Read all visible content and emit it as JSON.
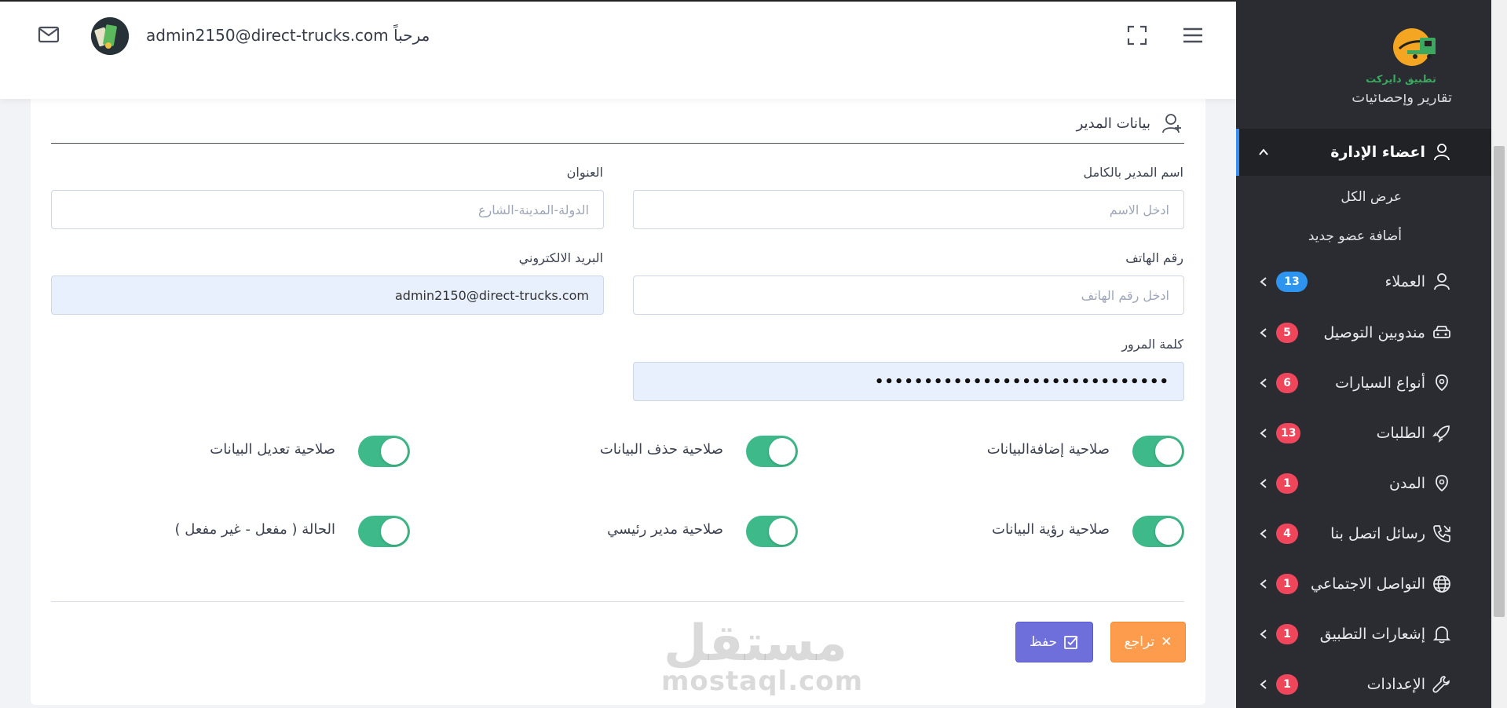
{
  "header": {
    "welcome_text": "admin2150@direct-trucks.com مرحباً"
  },
  "form": {
    "section_title": "بيانات المدير",
    "full_name": {
      "label": "اسم المدير بالكامل",
      "placeholder": "ادخل الاسم"
    },
    "address": {
      "label": "العنوان",
      "placeholder": "الدولة-المدينة-الشارع"
    },
    "phone": {
      "label": "رقم الهاتف",
      "placeholder": "ادخل رقم الهاتف"
    },
    "email": {
      "label": "البريد الالكتروني",
      "value": "admin2150@direct-trucks.com"
    },
    "password": {
      "label": "كلمة المرور",
      "value": "••••••••••••••••••••••••••••••"
    },
    "permissions": [
      {
        "label": "صلاحية إضافةالبيانات",
        "enabled": true
      },
      {
        "label": "صلاحية حذف البيانات",
        "enabled": true
      },
      {
        "label": "صلاحية تعديل البيانات",
        "enabled": true
      },
      {
        "label": "صلاحية رؤية البيانات",
        "enabled": true
      },
      {
        "label": "صلاحية مدير رئيسي",
        "enabled": true
      },
      {
        "label": "الحالة ( مفعل - غير مفعل )",
        "enabled": true
      }
    ],
    "save_label": "حفظ",
    "back_label": "تراجع",
    "save_icon": "✅",
    "back_icon": "✕"
  },
  "watermark": {
    "arabic": "مستقل",
    "english": "mostaql.com"
  },
  "sidebar": {
    "logo_text": "تطبيق دايركت",
    "peek_item": "تقارير وإحصائيات",
    "active_item": "اعضاء الإدارة",
    "sub_items": [
      "عرض الكل",
      "أضافة عضو جديد"
    ],
    "items": [
      {
        "label": "العملاء",
        "badge": "13",
        "badge_color": "#2d95ef",
        "icon": "user-icon"
      },
      {
        "label": "مندوبين التوصيل",
        "badge": "5",
        "badge_color": "#f0465c",
        "icon": "car-icon"
      },
      {
        "label": "أنواع السيارات",
        "badge": "6",
        "badge_color": "#f0465c",
        "icon": "shield-icon"
      },
      {
        "label": "الطلبات",
        "badge": "13",
        "badge_color": "#f0465c",
        "icon": "rocket-icon"
      },
      {
        "label": "المدن",
        "badge": "1",
        "badge_color": "#f0465c",
        "icon": "shield-icon"
      },
      {
        "label": "رسائل اتصل بنا",
        "badge": "4",
        "badge_color": "#f0465c",
        "icon": "phone-icon"
      },
      {
        "label": "التواصل الاجتماعي",
        "badge": "1",
        "badge_color": "#f0465c",
        "icon": "globe-icon"
      },
      {
        "label": "إشعارات التطبيق",
        "badge": "1",
        "badge_color": "#f0465c",
        "icon": "bell-icon"
      },
      {
        "label": "الإعدادات",
        "badge": "1",
        "badge_color": "#f0465c",
        "icon": "wrench-icon"
      }
    ]
  },
  "colors": {
    "accent_green": "#3eb989",
    "save_button": "#6f6fdc",
    "back_button": "#fe9c4d",
    "sidebar_bg": "#2a2c31",
    "active_border": "#3a8df0"
  }
}
